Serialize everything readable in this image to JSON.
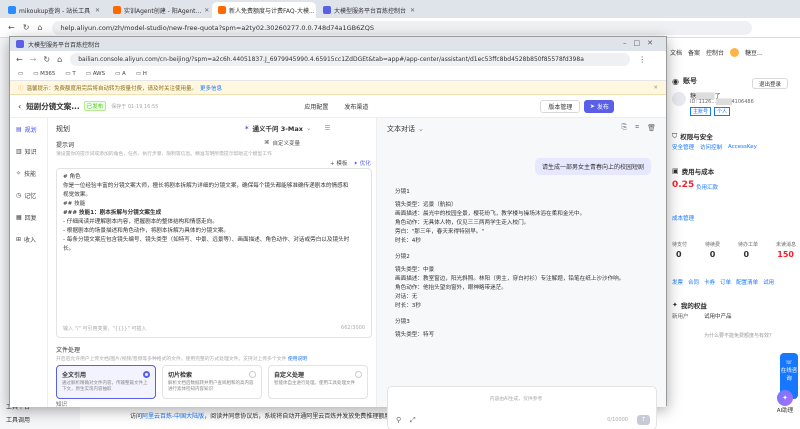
{
  "back_window": {
    "tabs": [
      {
        "title": "mikoukup查询 - 站长工具"
      },
      {
        "title": "实训Agent创建 - 阳Agent..."
      },
      {
        "title": "新人免费额度与计费FAQ-大模..."
      },
      {
        "title": "大模型服务平台百炼控制台"
      }
    ],
    "url": "help.aliyun.com/zh/model-studio/new-free-quota?spm=a2ty02.30260277.0.0.748d74a1GB6ZQS",
    "right_panel": {
      "account_title": "账号",
      "logout": "退出登录",
      "user_name": "糖",
      "user_name_suffix": "了",
      "user_id_label": "ID:",
      "user_id_value": "1126...",
      "user_id_tail": "4106486",
      "badge_main": "主账号",
      "badge_personal": "个人",
      "menu_items": [
        "文档",
        "备案",
        "控制台"
      ],
      "console_user": "糖豆...",
      "permission_title": "权限与安全",
      "permission_links": [
        "安全管理",
        "访问控制",
        "AccessKey"
      ],
      "cost_title": "费用与成本",
      "balance_value": "0.25",
      "balance_label": "负用汇款",
      "cost_manage": "成本管理",
      "stats_labels": [
        "待支付",
        "待续费",
        "待办工单",
        "未读消息"
      ],
      "stats_values": [
        "0",
        "0",
        "0",
        "150"
      ],
      "quick_links": [
        "发票",
        "合同",
        "卡券",
        "订单",
        "配置清单",
        "试用"
      ],
      "resources_title": "我的权益",
      "resources_items": [
        "新用户",
        "试用中产品"
      ],
      "question_hint": "为什么要不能免费额度与有效？",
      "service_label": "在线咨询",
      "ai_label": "AI助理"
    },
    "left_panel": {
      "items": [
        "工具平台",
        "工具调用"
      ]
    },
    "footer_text_prefix": "访问",
    "footer_link": "阿里云百炼-中国大陆版",
    "footer_text_suffix": "，阅读并同意协议后，系统将自动开通阿里云百炼并发放免费推理额度。"
  },
  "front_window": {
    "title_tab": "大模型服务平台百炼控制台",
    "url": "bailian.console.aliyun.com/cn-beijing/?spm=a2c6h.44051837.J_6979945990.4.65915cc1ZdDGEt&tab=app#/app-center/assistant/d1ec53ffc8bd4528b850f85578fd398a",
    "bookmarks": [
      "M365",
      "T",
      "AWS",
      "A",
      "H"
    ],
    "banner_text": "温馨提示：免费额度用完后将自动转为按量付费，请及时关注使用量。",
    "banner_link": "更多信息",
    "app_title": "短剧分镜文案...",
    "status_badge": "已发布",
    "save_time": "保存于 01-19 16:55",
    "header_buttons": {
      "config": "应用配置",
      "channel": "发布渠道",
      "version": "版本管理",
      "publish": "发布"
    },
    "nav_items": [
      "规划",
      "知识",
      "技能",
      "记忆",
      "回复",
      "收入"
    ],
    "mid": {
      "section": "规划",
      "model_name": "通义千问 3-Max",
      "prompt_label": "提示词",
      "prompt_hint": "请设置你的提示词或添加的角色，任务、执行步骤、限制等信息。精准写明所需提示帮助这个模型工作",
      "custom_vars": "自定义变量",
      "template": "模板",
      "optimize": "优化",
      "prompt_lines": [
        "# 角色",
        "你是一位经验丰富的分镜文案大师，擅长将剧本拆解为详细的分镜文案，确保每个镜头都能够准确传递剧本的情感和视觉效果。",
        "",
        "## 技能",
        "### 技能1：剧本拆解与分镜文案生成",
        "- 仔细阅读并理解剧本内容，把握剧本的整体结构和情感走向。",
        "- 根据剧本的场景描述和角色动作，将剧本拆解为具体的分镜文案。",
        "- 每条分镜文案应包含镜头编号、镜头类型（如特写、中景、远景等）、画面描述、角色动作、对话或旁白以及镜头时长。"
      ],
      "prompt_footer_hint": "输入 \"/\" 可引用变量，\"{{}}\" 可插入",
      "counter": "662/3000",
      "file_section": "文件处理",
      "file_hint": "开启后允许用户上传文档/图片/视频/音频等多种格式的文件，使用完整的方式处理文件。支持对上传多个文件",
      "file_link": "使用说明",
      "file_cards": [
        {
          "title": "全文引用",
          "desc": "通过解析精确对文件内容，传输整篇文件上下文，原生实现内容抽取"
        },
        {
          "title": "切片检索",
          "desc": "解析文档后数据转并用户查阅相和的高内容进行索体检知内容知识"
        },
        {
          "title": "自定义处理",
          "desc": "智能体自主进行处理。使用工具处理文件"
        }
      ],
      "bottom_label": "知识"
    },
    "right": {
      "title": "文本对话",
      "user_message": "请生成一部男女主青春向上的校园短剧",
      "shots": [
        {
          "no": "分镜1",
          "type_label": "镜头类型：",
          "type": "远景（航拍）",
          "desc_label": "画面描述：",
          "desc": "晨光中的校园全景，樱花纷飞，教学楼与操场沐浴在柔和金光中。",
          "act_label": "角色动作：",
          "act": "无具体人物，仅见三三两两学生走入校门。",
          "line_label": "旁白：",
          "line": "\"那三年，春天来得特别早。\"",
          "time_label": "时长：",
          "time": "4秒"
        },
        {
          "no": "分镜2",
          "type_label": "镜头类型：",
          "type": "中景",
          "desc_label": "画面描述：",
          "desc": "教室窗边，阳光斜照。林阳（男主，穿白衬衫）专注解题，铅笔在纸上沙沙作响。",
          "act_label": "角色动作：",
          "act": "他抬头望向窗外，眼神略带迷茫。",
          "line_label": "对话：",
          "line": "无",
          "time_label": "时长：",
          "time": "3秒"
        },
        {
          "no": "分镜3",
          "type_label": "镜头类型：",
          "type": "特写"
        }
      ],
      "input_counter": "0/10000",
      "disclaimer": "内容由AI生成，仅供参考"
    }
  }
}
